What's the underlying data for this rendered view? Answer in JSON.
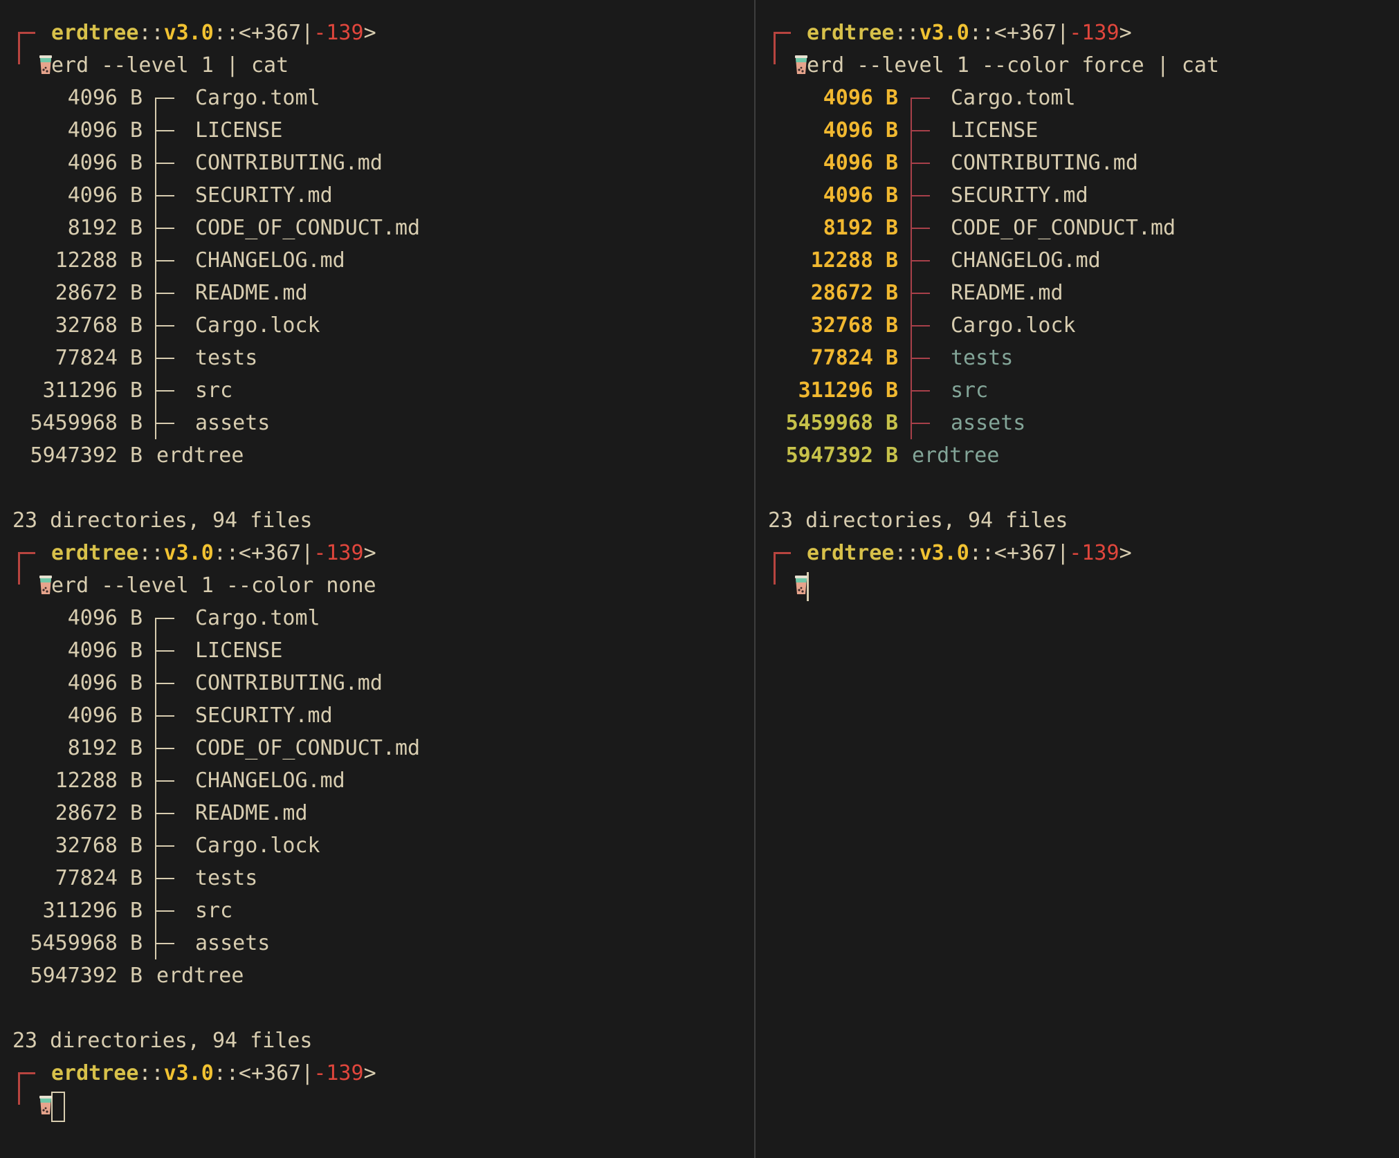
{
  "prompt": {
    "branch": "erdtree",
    "sep": "::",
    "version": "v3.0",
    "sep2": "::<",
    "added": "+367",
    "bar": "|",
    "removed": "-139",
    "close": ">"
  },
  "colors": {
    "background": "#1a1a1a",
    "text": "#d8cdb0",
    "accent_yellow": "#f1c232",
    "accent_red": "#e0463c",
    "dir_teal": "#83a598"
  },
  "icons": {
    "prompt": "boba-tea-cup-icon"
  },
  "commands": {
    "left_first": "erd --level 1 | cat",
    "left_second": "erd --level 1 --color none",
    "right_first": "erd --level 1 --color force | cat"
  },
  "tree": {
    "entries": [
      {
        "size": "4096",
        "unit": "B",
        "name": "Cargo.toml",
        "dir": false
      },
      {
        "size": "4096",
        "unit": "B",
        "name": "LICENSE",
        "dir": false
      },
      {
        "size": "4096",
        "unit": "B",
        "name": "CONTRIBUTING.md",
        "dir": false
      },
      {
        "size": "4096",
        "unit": "B",
        "name": "SECURITY.md",
        "dir": false
      },
      {
        "size": "8192",
        "unit": "B",
        "name": "CODE_OF_CONDUCT.md",
        "dir": false
      },
      {
        "size": "12288",
        "unit": "B",
        "name": "CHANGELOG.md",
        "dir": false
      },
      {
        "size": "28672",
        "unit": "B",
        "name": "README.md",
        "dir": false
      },
      {
        "size": "32768",
        "unit": "B",
        "name": "Cargo.lock",
        "dir": false
      },
      {
        "size": "77824",
        "unit": "B",
        "name": "tests",
        "dir": true
      },
      {
        "size": "311296",
        "unit": "B",
        "name": "src",
        "dir": true
      },
      {
        "size": "5459968",
        "unit": "B",
        "name": "assets",
        "dir": true
      }
    ],
    "root": {
      "size": "5947392",
      "unit": "B",
      "name": "erdtree"
    },
    "summary": "23 directories, 94 files"
  }
}
